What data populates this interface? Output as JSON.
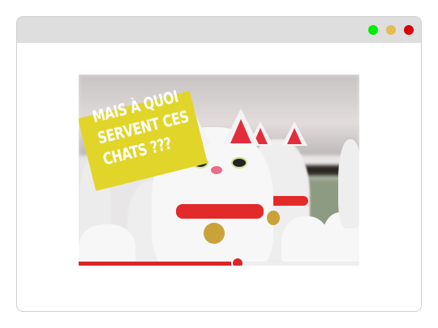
{
  "window": {
    "controls": [
      {
        "name": "maximize",
        "color": "#00ee00"
      },
      {
        "name": "minimize",
        "color": "#e8bb52"
      },
      {
        "name": "close",
        "color": "#dd0000"
      }
    ]
  },
  "video": {
    "thumbnail_title": "MAIS À QUOI SERVENT CES CHATS ???",
    "title_lines": [
      "MAIS À QUOI",
      "SERVENT CES",
      "CHATS ???"
    ],
    "banner_color": "#e2d52a",
    "progress_percent": 56.6,
    "progress_color": "#d8272a"
  }
}
